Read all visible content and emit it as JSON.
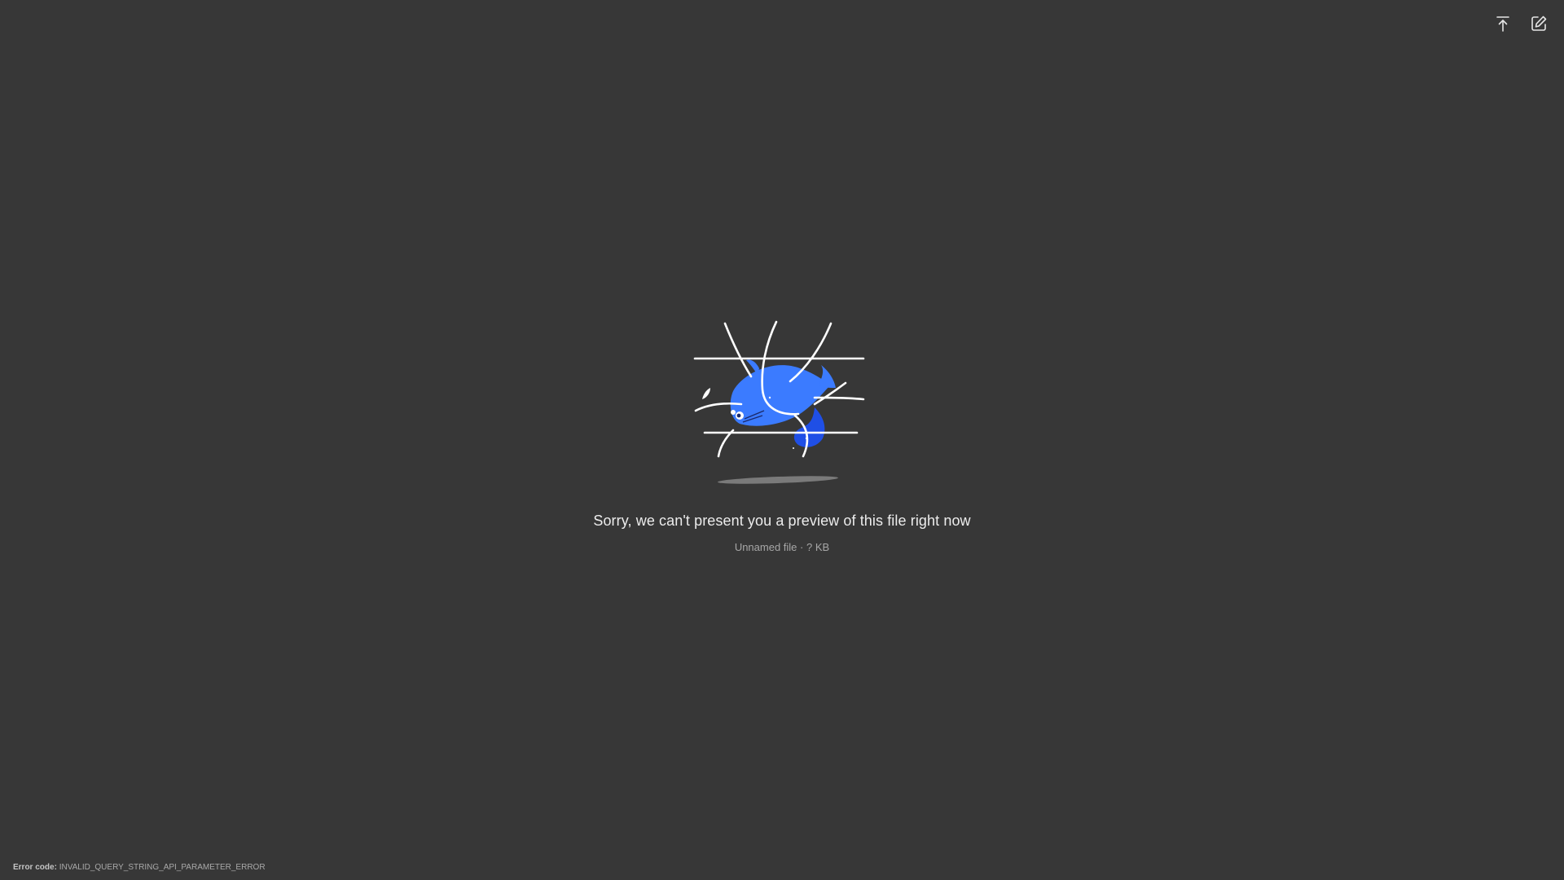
{
  "toolbar": {
    "upload_icon": "arrow-up-to-line-icon",
    "edit_icon": "edit-square-icon"
  },
  "preview": {
    "illustration": "caught-in-net-fish-illustration",
    "message": "Sorry, we can't present you a preview of this file right now",
    "file_name": "Unnamed file",
    "separator": " · ",
    "file_size": "? KB"
  },
  "error": {
    "label": "Error code:",
    "code": "INVALID_QUERY_STRING_API_PARAMETER_ERROR"
  },
  "colors": {
    "background": "#373737",
    "accent_blue": "#3b7bff",
    "deep_blue": "#1f4fe6"
  }
}
